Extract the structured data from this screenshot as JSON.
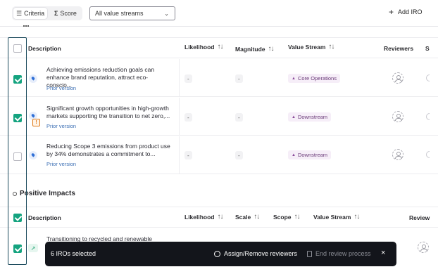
{
  "toolbar": {
    "criteria_label": "Criteria",
    "criteria_icon": "list-icon",
    "score_label": "Score",
    "score_icon": "sigma-icon",
    "value_stream_select": "All value streams",
    "add_iro_label": "Add IRO"
  },
  "table1": {
    "headers": {
      "description": "Description",
      "likelihood": "Likelihood",
      "magnitude": "Magnitude",
      "value_stream": "Value Stream",
      "reviewers": "Reviewers",
      "cut": "S"
    },
    "rows": [
      {
        "checked": true,
        "text": "Achieving emissions reduction goals can enhance brand reputation, attract eco-conscio...",
        "prior": "Prior version",
        "likelihood": "-",
        "magnitude": "-",
        "value_stream": "Core Operations"
      },
      {
        "checked": true,
        "warning": "!",
        "text": "Significant growth opportunities in high-growth markets supporting the transition to net zero,...",
        "prior": "Prior version",
        "likelihood": "-",
        "magnitude": "-",
        "value_stream": "Downstream"
      },
      {
        "checked": false,
        "text": "Reducing Scope 3 emissions from product use by 34% demonstrates a commitment to...",
        "prior": "Prior version",
        "likelihood": "-",
        "magnitude": "-",
        "value_stream": "Downstream"
      }
    ]
  },
  "section2": {
    "title": "Positive Impacts"
  },
  "table2": {
    "headers": {
      "description": "Description",
      "likelihood": "Likelihood",
      "scale": "Scale",
      "scope": "Scope",
      "value_stream": "Value Stream",
      "reviewers": "Review"
    },
    "rows": [
      {
        "checked": true,
        "text": "Transitioning to recycled and renewable"
      }
    ]
  },
  "actionbar": {
    "count": "6 IROs selected",
    "assign": "Assign/Remove reviewers",
    "end_review": "End review process",
    "close": "×"
  },
  "sort_glyph": "↑↓",
  "colors": {
    "checkbox_on": "#14a37f",
    "action_bar_bg": "#13151b",
    "prior_link": "#3c6fb4",
    "value_stream_bg": "#f6eef8",
    "selection_frame": "#1b4a5c"
  }
}
